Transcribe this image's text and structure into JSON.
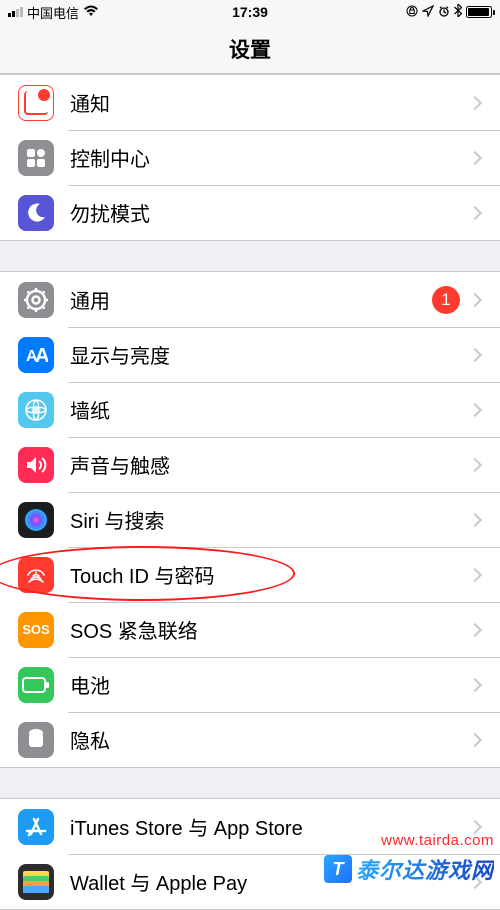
{
  "statusbar": {
    "carrier": "中国电信",
    "time": "17:39"
  },
  "header": {
    "title": "设置"
  },
  "groups": [
    {
      "rows": [
        {
          "icon": "notifications",
          "color": "#ff3b30",
          "label": "通知"
        },
        {
          "icon": "control-center",
          "color": "#8e8e93",
          "label": "控制中心"
        },
        {
          "icon": "dnd",
          "color": "#5856d6",
          "label": "勿扰模式"
        }
      ]
    },
    {
      "rows": [
        {
          "icon": "general",
          "color": "#8e8e93",
          "label": "通用",
          "badge": "1"
        },
        {
          "icon": "display",
          "color": "#007aff",
          "label": "显示与亮度"
        },
        {
          "icon": "wallpaper",
          "color": "#54c7ec",
          "label": "墙纸"
        },
        {
          "icon": "sounds",
          "color": "#ff2d55",
          "label": "声音与触感"
        },
        {
          "icon": "siri",
          "color": "#1c1c1e",
          "label": "Siri 与搜索"
        },
        {
          "icon": "touchid",
          "color": "#ff3b30",
          "label": "Touch ID 与密码"
        },
        {
          "icon": "sos",
          "color": "#ff9500",
          "label": "SOS 紧急联络"
        },
        {
          "icon": "battery",
          "color": "#34c759",
          "label": "电池"
        },
        {
          "icon": "privacy",
          "color": "#8e8e93",
          "label": "隐私"
        }
      ]
    },
    {
      "rows": [
        {
          "icon": "appstore",
          "color": "#1e9cf4",
          "label": "iTunes Store 与 App Store"
        },
        {
          "icon": "wallet",
          "color": "#2c2c2e",
          "label": "Wallet 与 Apple Pay"
        }
      ]
    }
  ],
  "annotation": {
    "target_label": "Touch ID 与密码"
  },
  "watermark": {
    "url": "www.tairda.com",
    "brand": "泰尔达游戏网",
    "brand_initial": "T"
  }
}
